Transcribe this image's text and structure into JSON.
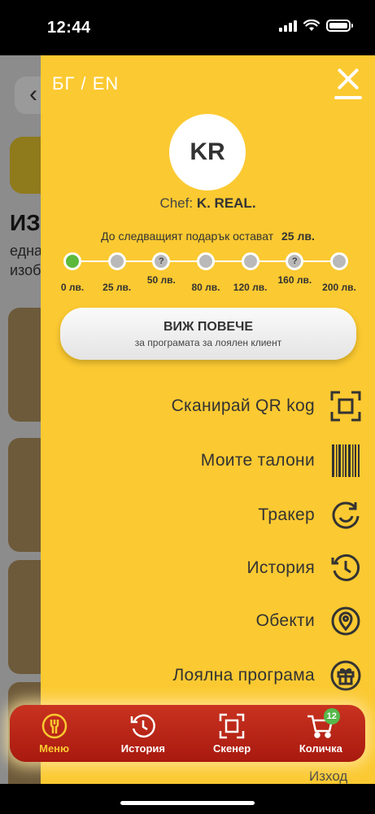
{
  "status_bar": {
    "time": "12:44"
  },
  "background": {
    "title": "ИЗ",
    "subtitle_line1": "една",
    "subtitle_line2": "изоб"
  },
  "drawer": {
    "lang_switch": "БГ / EN",
    "avatar_initials": "KR",
    "chef_prefix": "Chef: ",
    "chef_name": "K. REAL.",
    "next_gift_text": "До следващият подарък остават",
    "next_gift_amount": "25 лв.",
    "progress": {
      "current_step": 0,
      "steps": [
        {
          "label": "0 лв.",
          "mark": ""
        },
        {
          "label": "25 лв.",
          "mark": ""
        },
        {
          "label": "50 лв.",
          "mark": "?"
        },
        {
          "label": "80 лв.",
          "mark": ""
        },
        {
          "label": "120 лв.",
          "mark": ""
        },
        {
          "label": "160 лв.",
          "mark": "?"
        },
        {
          "label": "200 лв.",
          "mark": ""
        }
      ]
    },
    "more_button": {
      "title": "ВИЖ ПОВЕЧЕ",
      "subtitle": "за програмата за лоялен клиент"
    },
    "menu": [
      {
        "label": "Сканирай QR kog",
        "icon": "qr-scan-icon"
      },
      {
        "label": "Моите талони",
        "icon": "barcode-icon"
      },
      {
        "label": "Тракер",
        "icon": "refresh-icon"
      },
      {
        "label": "История",
        "icon": "history-icon"
      },
      {
        "label": "Обекти",
        "icon": "location-pin-icon"
      },
      {
        "label": "Лоялна програма",
        "icon": "gift-icon"
      }
    ],
    "menu_peek": "Изход"
  },
  "tab_bar": {
    "tabs": [
      {
        "label": "Меню",
        "icon": "restaurant-icon",
        "active": true
      },
      {
        "label": "История",
        "icon": "history-icon",
        "active": false
      },
      {
        "label": "Скенер",
        "icon": "scan-icon",
        "active": false
      },
      {
        "label": "Количка",
        "icon": "cart-icon",
        "active": false,
        "badge": "12"
      }
    ]
  },
  "colors": {
    "drawer_bg": "#fbc931",
    "tab_bar": "#b5200f",
    "progress_active": "#5cb93c",
    "badge": "#56b84b"
  }
}
